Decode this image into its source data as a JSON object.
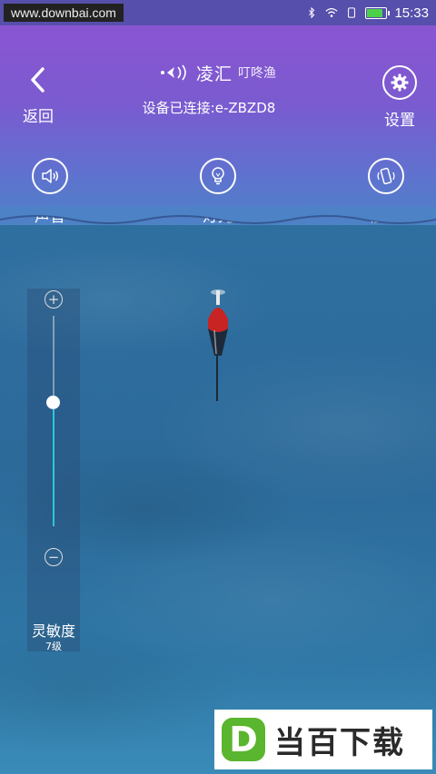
{
  "status_bar": {
    "watermark": "www.downbai.com",
    "time": "15:33",
    "battery_level": 0.85
  },
  "header": {
    "back_label": "返回",
    "logo_text": "凌汇",
    "logo_sub": "叮咚渔",
    "connection_status": "设备已连接:e-ZBZD8",
    "settings_label": "设置"
  },
  "controls": [
    {
      "label": "声音",
      "icon": "speaker-icon"
    },
    {
      "label": "灯光",
      "icon": "lightbulb-icon"
    },
    {
      "label": "震动",
      "icon": "vibrate-icon"
    }
  ],
  "sensitivity": {
    "label": "灵敏度",
    "level_text": "7级",
    "value_fraction": 0.59
  },
  "footer_logo": {
    "badge": "D",
    "text": "当百下载"
  },
  "colors": {
    "header_purple": "#8a55d2",
    "slider_fill": "#2ec7d8",
    "badge_green": "#5ab52f"
  }
}
